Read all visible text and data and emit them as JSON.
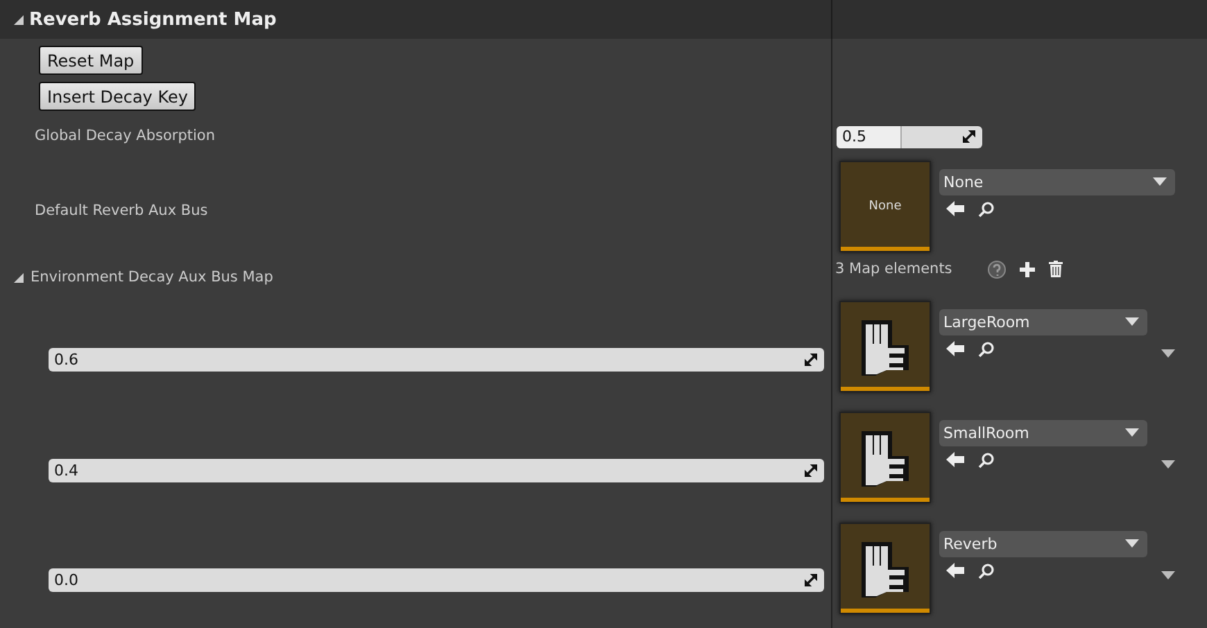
{
  "section": {
    "title": "Reverb Assignment Map",
    "expanded": true
  },
  "buttons": [
    "Reset Map",
    "Insert Decay Key"
  ],
  "global_decay": {
    "label": "Global Decay Absorption",
    "value": "0.5",
    "level": 0.44
  },
  "default_bus": {
    "label": "Default Reverb Aux Bus",
    "thumbnail": {
      "kind": "text",
      "text": "None"
    },
    "selection": "None"
  },
  "map": {
    "label": "Environment Decay Aux Bus Map",
    "expanded": true,
    "count": "3 Map elements",
    "elements": [
      {
        "key": "0.6",
        "thumbnail": {
          "kind": "icon"
        },
        "selection": "LargeRoom"
      },
      {
        "key": "0.4",
        "thumbnail": {
          "kind": "icon"
        },
        "selection": "SmallRoom"
      },
      {
        "key": "0.0",
        "thumbnail": {
          "kind": "icon"
        },
        "selection": "Reverb"
      }
    ]
  }
}
